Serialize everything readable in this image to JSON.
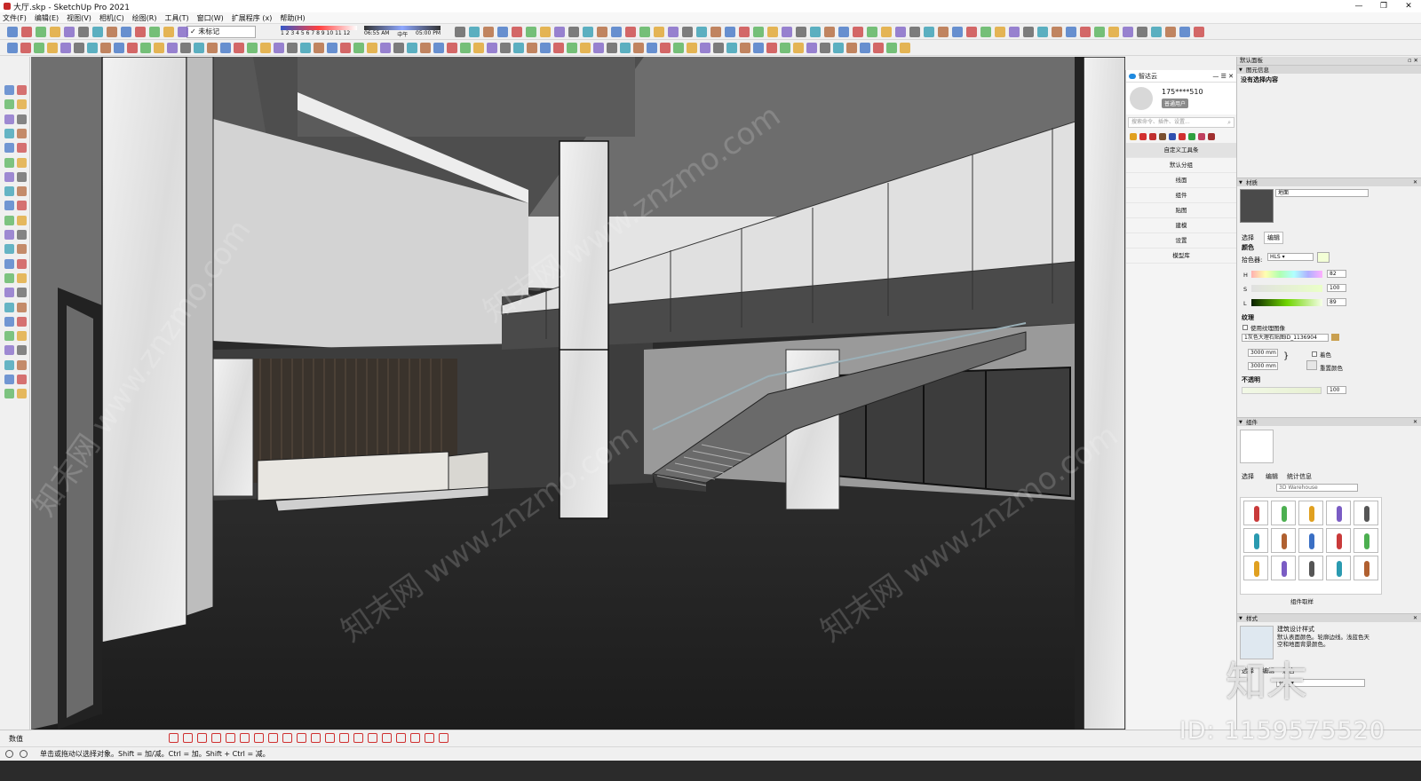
{
  "window": {
    "title": "大厅.skp - SketchUp Pro 2021",
    "controls": [
      "—",
      "❐",
      "✕"
    ]
  },
  "menu": [
    "文件(F)",
    "编辑(E)",
    "视图(V)",
    "相机(C)",
    "绘图(R)",
    "工具(T)",
    "窗口(W)",
    "扩展程序 (x)",
    "帮助(H)"
  ],
  "toolbar": {
    "tag_combo": "未标记",
    "shadow_months": "1 2 3 4 5 6 7 8 9 10 11 12",
    "shadow_time_start": "06:55 AM",
    "shadow_time_mid": "中午",
    "shadow_time_end": "05:00 PM"
  },
  "viewport": {
    "watermark_text": "知末网 www.znzmo.com"
  },
  "zd_panel": {
    "title": "智达云",
    "user_name": "175****510",
    "user_badge": "普通用户",
    "search_placeholder": "搜索命令、插件、设置...",
    "nav": [
      "自定义工具条",
      "默认分组",
      "线面",
      "组件",
      "贴图",
      "建模",
      "设置",
      "模型库"
    ]
  },
  "tray": {
    "title": "默认面板",
    "entity_info": {
      "header": "图元信息",
      "empty": "没有选择内容"
    },
    "materials": {
      "header": "材质",
      "name": "地面",
      "tabs": [
        "选择",
        "编辑"
      ],
      "color_label": "颜色",
      "picker_label": "拾色器:",
      "picker_value": "HLS",
      "h_label": "H",
      "h_value": "82",
      "s_label": "S",
      "s_value": "100",
      "l_label": "L",
      "l_value": "89",
      "texture_label": "纹理",
      "use_texture": "使用纹理图像",
      "texture_file": "1灰色大理石贴图ID_1136904",
      "width": "3000 mm",
      "height": "3000 mm",
      "colorize": "着色",
      "reset_color": "重置颜色",
      "opacity_label": "不透明",
      "opacity_value": "100"
    },
    "components": {
      "header": "组件",
      "tabs": [
        "选择",
        "编辑",
        "统计信息"
      ],
      "search_placeholder": "3D Warehouse",
      "footer": "组件取样"
    },
    "styles": {
      "header": "样式",
      "name": "建筑设计样式",
      "description": "默认表面颜色。轮廓边线。浅蓝色天空和地面背景颜色。",
      "tabs": [
        "选择",
        "编辑",
        "混合"
      ],
      "combo": "样式"
    }
  },
  "measure": {
    "label": "数值"
  },
  "status": {
    "text": "单击或拖动以选择对象。Shift = 加/减。Ctrl = 加。Shift + Ctrl = 减。"
  },
  "overlay": {
    "id_text": "ID: 1159575520",
    "logo_text": "知末"
  }
}
